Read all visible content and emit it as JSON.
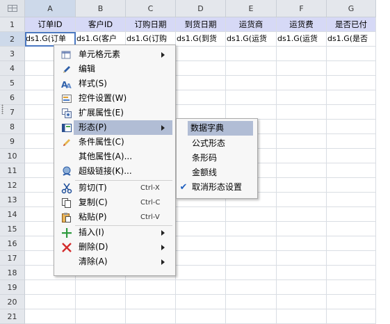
{
  "sheet": {
    "columns": [
      "A",
      "B",
      "C",
      "D",
      "E",
      "F",
      "G"
    ],
    "rows": [
      "1",
      "2",
      "3",
      "4",
      "5",
      "6",
      "7",
      "8",
      "9",
      "10",
      "11",
      "12",
      "13",
      "14",
      "15",
      "16",
      "17",
      "18",
      "19",
      "20",
      "21"
    ],
    "header_row": [
      "订单ID",
      "客户ID",
      "订购日期",
      "到货日期",
      "运货商",
      "运货费",
      "是否已付"
    ],
    "data_row": [
      "ds1.G(订单",
      "ds1.G(客户",
      "ds1.G(订购",
      "ds1.G(到货",
      "ds1.G(运货",
      "ds1.G(运货",
      "ds1.G(是否"
    ],
    "selected_column": "A",
    "selected_row": "2"
  },
  "context_menu": {
    "items": [
      {
        "label": "单元格元素",
        "icon": "cell-element-icon",
        "submenu": true
      },
      {
        "label": "编辑",
        "icon": "pen-icon"
      },
      {
        "label": "样式(S)",
        "icon": "style-icon"
      },
      {
        "label": "控件设置(W)",
        "icon": "widget-settings-icon"
      },
      {
        "label": "扩展属性(E)",
        "icon": "expand-attr-icon"
      },
      {
        "label": "形态(P)",
        "icon": "shape-icon",
        "submenu": true,
        "highlighted": true
      },
      {
        "label": "条件属性(C)",
        "icon": "condition-icon"
      },
      {
        "label": "其他属性(A)...",
        "icon": ""
      },
      {
        "label": "超级链接(K)...",
        "icon": "hyperlink-icon"
      },
      {
        "label": "剪切(T)",
        "icon": "scissors-icon",
        "shortcut": "Ctrl-X"
      },
      {
        "label": "复制(C)",
        "icon": "copy-icon",
        "shortcut": "Ctrl-C"
      },
      {
        "label": "粘贴(P)",
        "icon": "paste-icon",
        "shortcut": "Ctrl-V"
      },
      {
        "label": "插入(I)",
        "icon": "plus-icon",
        "submenu": true
      },
      {
        "label": "删除(D)",
        "icon": "delete-x-icon",
        "submenu": true
      },
      {
        "label": "清除(A)",
        "icon": "",
        "submenu": true
      }
    ]
  },
  "submenu": {
    "items": [
      {
        "label": "数据字典",
        "highlighted": true
      },
      {
        "label": "公式形态"
      },
      {
        "label": "条形码"
      },
      {
        "label": "金额线"
      },
      {
        "label": "取消形态设置",
        "checked": true
      }
    ]
  },
  "colors": {
    "header_fill": "#d6d9f6",
    "selection_border": "#4a78c2",
    "menu_highlight": "#b1bdd5",
    "check": "#1f5fbf"
  }
}
